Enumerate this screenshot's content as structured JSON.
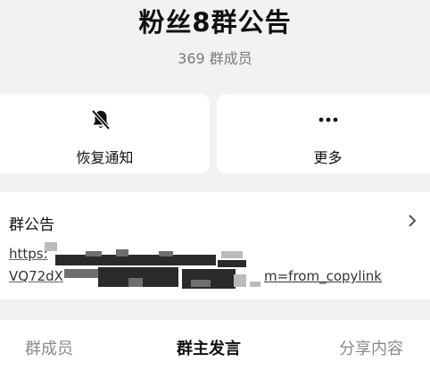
{
  "header": {
    "title": "粉丝8群公告",
    "member_count": "369 群成员"
  },
  "actions": [
    {
      "label": "恢复通知",
      "icon": "bell-slash-icon"
    },
    {
      "label": "更多",
      "icon": "more-dots-icon"
    }
  ],
  "notice": {
    "title": "群公告",
    "link_line1": "https:",
    "link_line2_start": "VQ72dX",
    "link_line2_end": "m=from_copylink"
  },
  "tabs": [
    {
      "label": "群成员",
      "active": false
    },
    {
      "label": "群主发言",
      "active": true
    },
    {
      "label": "分享内容",
      "active": false
    }
  ]
}
